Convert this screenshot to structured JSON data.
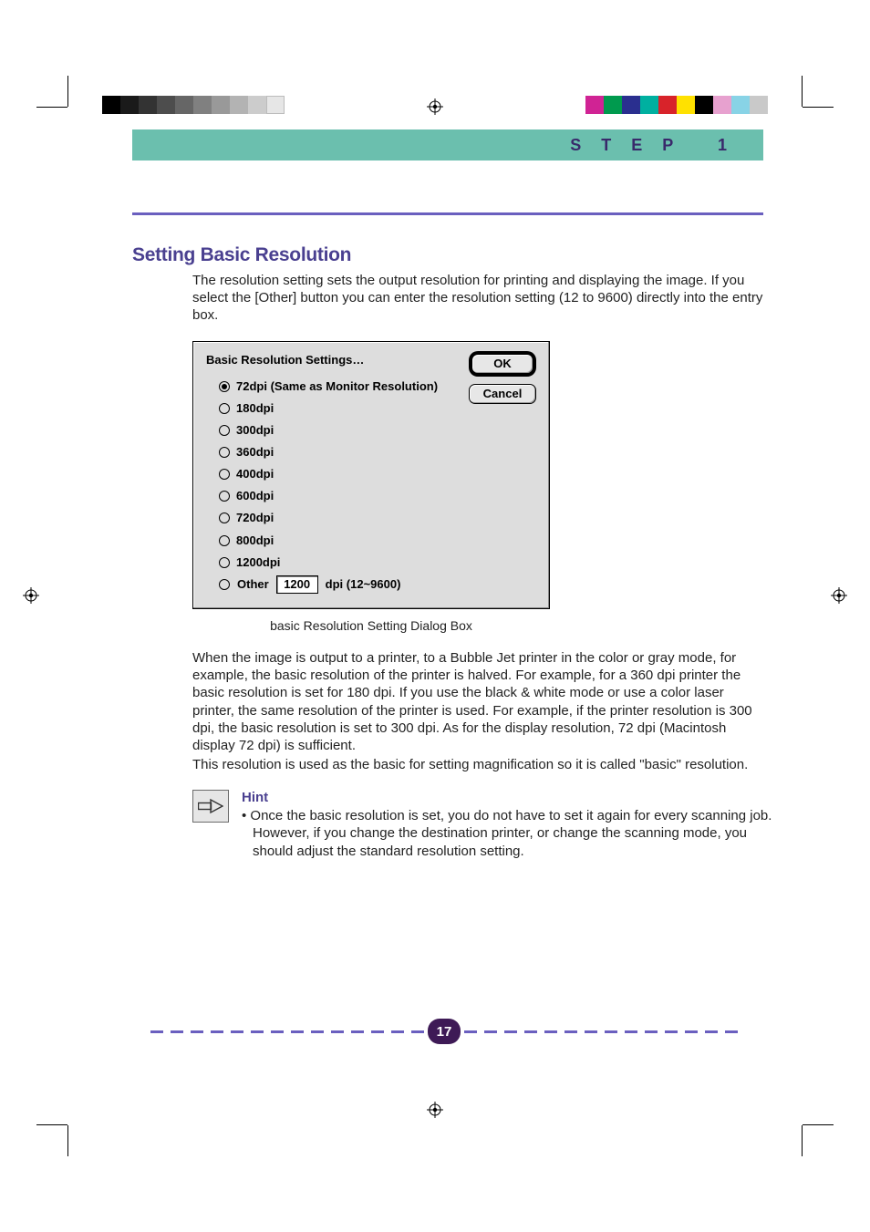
{
  "header": {
    "step_label": "STEP 1"
  },
  "section_heading": "Setting Basic Resolution",
  "intro_text": "The resolution setting sets the output resolution for printing and displaying the image. If you select the [Other] button you can enter the resolution setting (12 to 9600) directly into the entry box.",
  "dialog": {
    "title": "Basic Resolution Settings…",
    "ok_label": "OK",
    "cancel_label": "Cancel",
    "options": [
      {
        "label": "72dpi (Same as Monitor Resolution)",
        "selected": true
      },
      {
        "label": "180dpi",
        "selected": false
      },
      {
        "label": "300dpi",
        "selected": false
      },
      {
        "label": "360dpi",
        "selected": false
      },
      {
        "label": "400dpi",
        "selected": false
      },
      {
        "label": "600dpi",
        "selected": false
      },
      {
        "label": "720dpi",
        "selected": false
      },
      {
        "label": "800dpi",
        "selected": false
      },
      {
        "label": "1200dpi",
        "selected": false
      }
    ],
    "other_label": "Other",
    "other_value": "1200",
    "other_suffix": "dpi  (12~9600)"
  },
  "caption": "basic Resolution Setting Dialog Box",
  "body_para_1": "When the image is output to a printer, to a Bubble Jet printer in the color or gray mode, for example, the basic resolution of the printer is halved. For example, for a 360 dpi printer the basic resolution is set for 180 dpi. If you use the black & white mode or use a color laser printer, the same resolution of the printer is used. For example, if the printer resolution is 300 dpi, the basic resolution is set to 300 dpi. As for the display resolution, 72 dpi (Macintosh display 72 dpi) is sufficient.",
  "body_para_2": "This resolution is used as the basic for setting magnification so it is called \"basic\" resolution.",
  "hint": {
    "heading": "Hint",
    "text": "• Once the basic resolution is set, you do not have to set it again for every scanning job.  However, if you change the destination printer, or change the scanning mode, you should adjust the standard resolution setting."
  },
  "page_number": "17"
}
